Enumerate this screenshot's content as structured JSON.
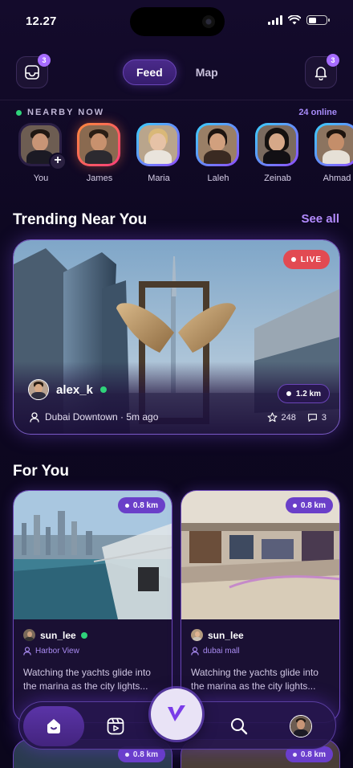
{
  "status_bar": {
    "time": "12.27"
  },
  "top_bar": {
    "inbox_badge": "3",
    "bell_badge": "3",
    "tabs": [
      {
        "label": "Feed",
        "active": true
      },
      {
        "label": "Map",
        "active": false
      }
    ]
  },
  "nearby": {
    "title": "NEARBY NOW",
    "online": "24 online",
    "people": [
      {
        "name": "You"
      },
      {
        "name": "James"
      },
      {
        "name": "Maria"
      },
      {
        "name": "Laleh"
      },
      {
        "name": "Zeinab"
      },
      {
        "name": "Ahmad"
      }
    ]
  },
  "trending": {
    "title": "Trending Near You",
    "see_all": "See all",
    "live_label": "LIVE",
    "username": "alex_k",
    "location": "Dubai Downtown · 5m ago",
    "distance": "1.2 km",
    "likes": "248",
    "comments": "3"
  },
  "for_you": {
    "title": "For You",
    "cards": [
      {
        "distance": "0.8 km",
        "username": "sun_lee",
        "location": "Harbor View",
        "caption": "Watching the yachts glide into the marina as the city lights..."
      },
      {
        "distance": "0.8 km",
        "username": "sun_lee",
        "location": "dubai mall",
        "caption": "Watching the yachts glide into the marina as the city lights..."
      }
    ],
    "peek_distance": "0.8 km"
  },
  "colors": {
    "accent": "#a66cff",
    "live": "#e24a52",
    "online": "#2fd37a",
    "background": "#0d0820"
  },
  "icons": {
    "inbox": "inbox-icon",
    "bell": "bell-icon",
    "home": "home-icon",
    "reels": "reels-icon",
    "search": "search-icon",
    "logo": "logo-check-icon"
  }
}
